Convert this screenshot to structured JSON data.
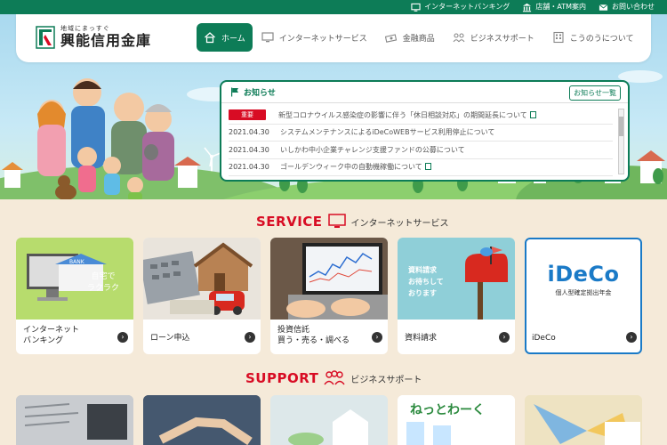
{
  "topbar": {
    "links": [
      {
        "label": "インターネットバンキング",
        "icon": "monitor-icon"
      },
      {
        "label": "店舗・ATM案内",
        "icon": "bank-icon"
      },
      {
        "label": "お問い合わせ",
        "icon": "mail-icon"
      }
    ]
  },
  "logo": {
    "tagline": "地域にまっすぐ",
    "name": "興能信用金庫"
  },
  "nav": {
    "items": [
      {
        "label": "ホーム",
        "icon": "home-icon"
      },
      {
        "label": "インターネットサービス",
        "icon": "monitor-icon"
      },
      {
        "label": "金融商品",
        "icon": "money-icon"
      },
      {
        "label": "ビジネスサポート",
        "icon": "people-icon"
      },
      {
        "label": "こうのうについて",
        "icon": "building-icon"
      }
    ]
  },
  "news": {
    "title": "お知らせ",
    "all_label": "お知らせ一覧",
    "items": [
      {
        "date": "",
        "badge": "重要",
        "text": "新型コロナウイルス感染症の影響に伴う「休日相談対応」の期間延長について"
      },
      {
        "date": "2021.04.30",
        "badge": "",
        "text": "システムメンテナンスによるiDeCoWEBサービス利用停止について"
      },
      {
        "date": "2021.04.30",
        "badge": "",
        "text": "いしかわ中小企業チャレンジ支援ファンドの公募について"
      },
      {
        "date": "2021.04.30",
        "badge": "",
        "text": "ゴールデンウィーク中の自動機稼働について"
      }
    ]
  },
  "service": {
    "title_en": "SERVICE",
    "title_jp": "インターネットサービス",
    "cards": [
      {
        "label_line1": "インターネット",
        "label_line2": "バンキング",
        "overlay_1": "自宅で",
        "overlay_2": "ラクラク",
        "sign": "BANK"
      },
      {
        "label_line1": "ローン申込",
        "label_line2": ""
      },
      {
        "label_line1": "投資信託",
        "label_line2": "買う・売る・調べる"
      },
      {
        "label_line1": "資料請求",
        "label_line2": "",
        "overlay_1": "資料請求",
        "overlay_2": "お待ちして",
        "overlay_3": "おります"
      },
      {
        "label_line1": "iDeCo",
        "label_line2": "",
        "logo_text": "iDeCo",
        "logo_sub": "個人型確定拠出年金"
      }
    ]
  },
  "support": {
    "title_en": "SUPPORT",
    "title_jp": "ビジネスサポート",
    "card3_text": "ねっとわーく"
  },
  "colors": {
    "brand_green": "#0d7c57",
    "accent_red": "#d80c24",
    "page_bg": "#f5ead9"
  }
}
